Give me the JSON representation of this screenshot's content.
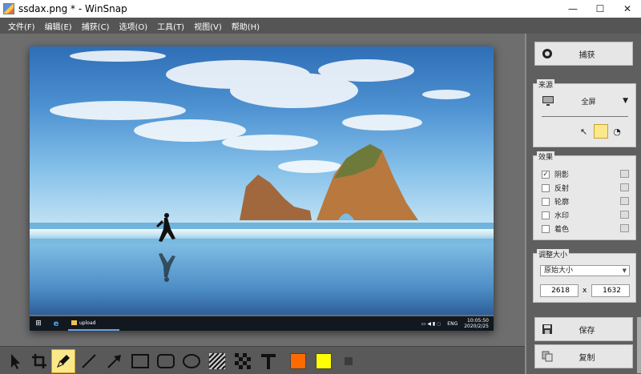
{
  "window": {
    "title": "ssdax.png * - WinSnap",
    "controls": {
      "minimize": "—",
      "maximize": "☐",
      "close": "✕"
    }
  },
  "menu": {
    "items": [
      "文件(F)",
      "编辑(E)",
      "捕获(C)",
      "选项(O)",
      "工具(T)",
      "视图(V)",
      "帮助(H)"
    ]
  },
  "screenshot": {
    "taskbar": {
      "folder_label": "upload",
      "ime": "ENG",
      "time": "10:05:50",
      "date": "2020/2/25"
    }
  },
  "panel": {
    "capture_button": "捕获",
    "source": {
      "title": "来源",
      "mode": "全屏"
    },
    "effects": {
      "title": "效果",
      "items": [
        {
          "label": "阴影",
          "checked": true
        },
        {
          "label": "反射",
          "checked": false
        },
        {
          "label": "轮廓",
          "checked": false
        },
        {
          "label": "水印",
          "checked": false
        },
        {
          "label": "着色",
          "checked": false
        }
      ]
    },
    "resize": {
      "title": "调整大小",
      "mode": "原始大小",
      "width": "2618",
      "height": "1632",
      "separator": "x"
    },
    "save_button": "保存",
    "copy_button": "复制"
  },
  "toolbar": {
    "tools": [
      "pointer-icon",
      "crop-icon",
      "pen-icon",
      "line-icon",
      "arrow-icon",
      "rectangle-icon",
      "rounded-rectangle-icon",
      "ellipse-icon",
      "hatch-icon",
      "pixelate-icon",
      "text-icon"
    ],
    "selected_tool": "pen-icon",
    "colors": {
      "primary": "#ff6a00",
      "secondary": "#ffff00",
      "small": "#3c3c3c"
    }
  }
}
